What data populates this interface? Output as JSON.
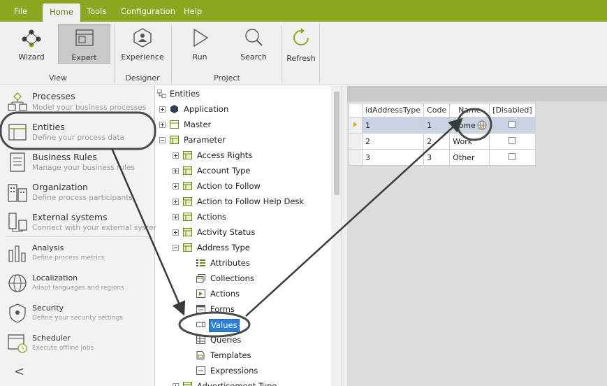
{
  "menu": {
    "items": [
      "File",
      "Home",
      "Tools",
      "Configuration",
      "Help"
    ],
    "active": "Home"
  },
  "ribbon": {
    "view": {
      "group_label": "View",
      "wizard": "Wizard",
      "expert": "Expert"
    },
    "designer": {
      "group_label": "Designer",
      "experience": "Experience"
    },
    "project": {
      "group_label": "Project",
      "run": "Run",
      "search": "Search"
    },
    "refresh": "Refresh"
  },
  "leftnav": {
    "items": [
      {
        "title": "Processes",
        "subtitle": "Model your business processes"
      },
      {
        "title": "Entities",
        "subtitle": "Define your process data"
      },
      {
        "title": "Business Rules",
        "subtitle": "Manage your business rules"
      },
      {
        "title": "Organization",
        "subtitle": "Define process participants"
      },
      {
        "title": "External systems",
        "subtitle": "Connect with your external systems"
      },
      {
        "title": "Analysis",
        "subtitle": "Define process metrics"
      },
      {
        "title": "Localization",
        "subtitle": "Adapt languages and regions"
      },
      {
        "title": "Security",
        "subtitle": "Define your security settings"
      },
      {
        "title": "Scheduler",
        "subtitle": "Execute offline jobs"
      }
    ],
    "collapse_glyph": "<"
  },
  "tree": {
    "root": "Entities",
    "nodes": [
      "Application",
      "Master",
      "Parameter",
      "Access Rights",
      "Account Type",
      "Action to Follow",
      "Action to Follow Help Desk",
      "Actions",
      "Activity Status",
      "Address Type",
      "Attributes",
      "Collections",
      "Actions",
      "Forms",
      "Values",
      "Queries",
      "Templates",
      "Expressions",
      "Advertisement Type"
    ],
    "selected": "Values"
  },
  "grid": {
    "columns": [
      "idAddressType",
      "Code",
      "Name",
      "[Disabled]"
    ],
    "rows": [
      {
        "id": "1",
        "code": "1",
        "name": "Home"
      },
      {
        "id": "2",
        "code": "2",
        "name": "Work"
      },
      {
        "id": "3",
        "code": "3",
        "name": "Other"
      }
    ]
  },
  "colors": {
    "accent": "#8aa71f",
    "selection": "#2a7fd4",
    "annotation": "#3a3a3a"
  }
}
